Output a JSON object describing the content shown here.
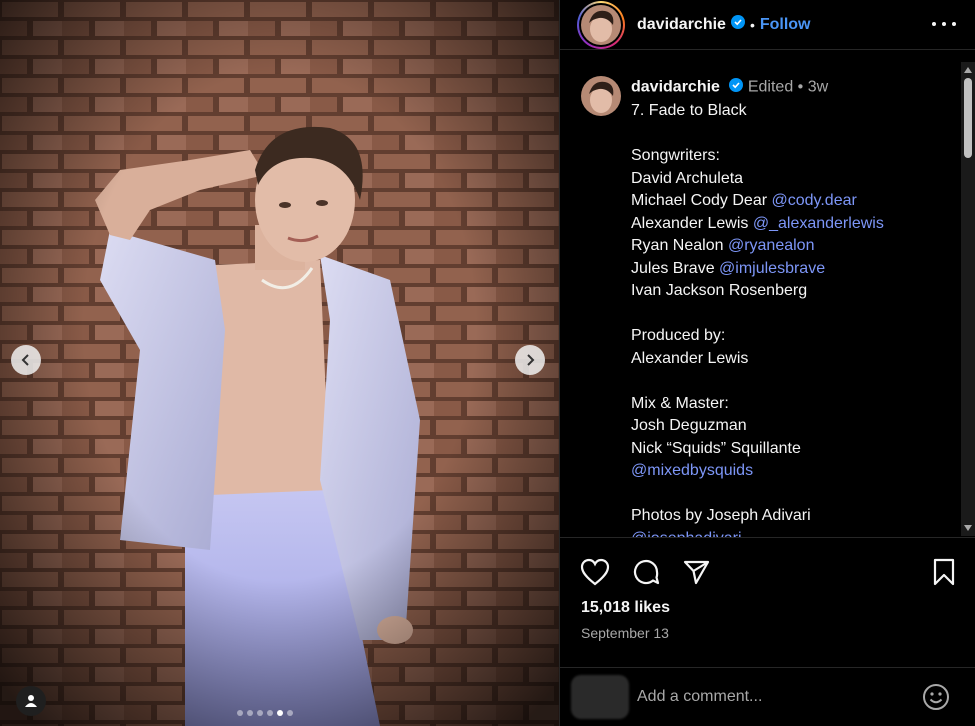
{
  "post": {
    "username": "davidarchie",
    "follow_label": "Follow",
    "separator": "•"
  },
  "caption": {
    "username": "davidarchie",
    "edited": "Edited",
    "time": "3w",
    "lines": [
      {
        "text": "7. Fade to Black"
      },
      {
        "text": ""
      },
      {
        "text": "Songwriters:"
      },
      {
        "text": "David Archuleta"
      },
      {
        "text": "Michael Cody Dear ",
        "mention": "@cody.dear"
      },
      {
        "text": "Alexander Lewis ",
        "mention": "@_alexanderlewis"
      },
      {
        "text": "Ryan Nealon ",
        "mention": "@ryanealon"
      },
      {
        "text": "Jules Brave ",
        "mention": "@imjulesbrave"
      },
      {
        "text": "Ivan Jackson Rosenberg"
      },
      {
        "text": ""
      },
      {
        "text": "Produced by:"
      },
      {
        "text": "Alexander Lewis"
      },
      {
        "text": ""
      },
      {
        "text": "Mix & Master:"
      },
      {
        "text": "Josh Deguzman"
      },
      {
        "text": "Nick “Squids” Squillante"
      },
      {
        "text": "",
        "mention": "@mixedbysquids"
      },
      {
        "text": ""
      },
      {
        "text": "Photos by Joseph Adivari"
      },
      {
        "text": "",
        "mention": "@josephadivari"
      }
    ]
  },
  "stats": {
    "likes": "15,018 likes",
    "date": "September 13"
  },
  "comment": {
    "placeholder": "Add a comment..."
  },
  "carousel": {
    "slide_count": 6,
    "active_index": 4
  },
  "icons": {
    "verified": "verified-badge-icon",
    "more": "more-options-icon",
    "like": "heart-icon",
    "comment": "comment-bubble-icon",
    "share": "paper-plane-icon",
    "save": "bookmark-icon",
    "emoji": "emoji-smile-icon",
    "prev": "chevron-left-icon",
    "next": "chevron-right-icon",
    "tag": "user-tag-icon"
  },
  "colors": {
    "link": "#7d96f7",
    "follow": "#4a95f5",
    "verified": "#0095f6"
  }
}
